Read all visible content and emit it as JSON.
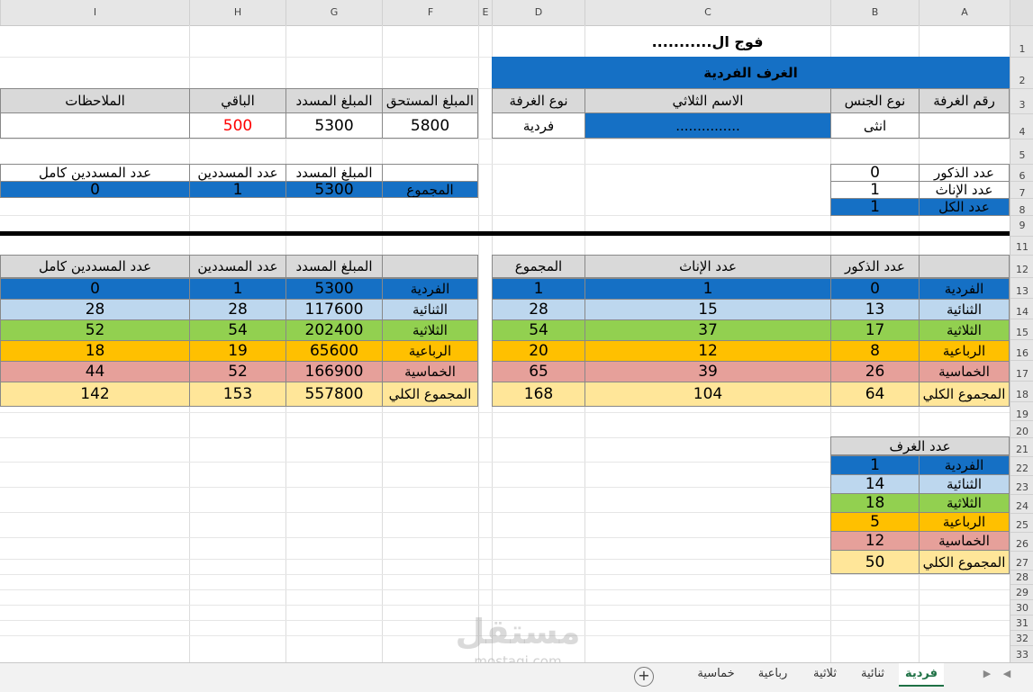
{
  "columns": [
    "A",
    "B",
    "C",
    "D",
    "E",
    "F",
    "G",
    "H",
    "I"
  ],
  "rows": [
    "1",
    "2",
    "3",
    "4",
    "5",
    "6",
    "7",
    "8",
    "9",
    "11",
    "12",
    "13",
    "14",
    "15",
    "16",
    "17",
    "18",
    "19",
    "20",
    "21",
    "22",
    "23",
    "24",
    "25",
    "26",
    "27",
    "28",
    "29",
    "30",
    "31",
    "32",
    "33"
  ],
  "title": "فوج ال...........",
  "section_title": "الغرف الفردية",
  "info": {
    "h_room_no": "رقم الغرفة",
    "h_gender": "نوع الجنس",
    "h_name": "الاسم الثلاثي",
    "h_room_type": "نوع الغرفة",
    "h_due": "المبلغ المستحق",
    "h_paid": "المبلغ المسدد",
    "h_remaining": "الباقي",
    "h_notes": "الملاحظات",
    "gender": "انثى",
    "name": "...............",
    "room_type": "فردية",
    "due": "5800",
    "paid": "5300",
    "remaining": "500",
    "notes": ""
  },
  "counts": {
    "males_label": "عدد الذكور",
    "males": "0",
    "females_label": "عدد الإناث",
    "females": "1",
    "total_label": "عدد الكل",
    "total": "1"
  },
  "summary": {
    "h_paid": "المبلغ المسدد",
    "h_payers": "عدد المسددين",
    "h_full_payers": "عدد المسددين كامل",
    "label": "المجموع",
    "paid": "5300",
    "payers": "1",
    "full_payers": "0"
  },
  "left_table": {
    "headers": [
      "عدد الذكور",
      "عدد الإناث",
      "المجموع"
    ],
    "rows": [
      {
        "label": "الفردية",
        "males": "0",
        "females": "1",
        "total": "1"
      },
      {
        "label": "الثنائية",
        "males": "13",
        "females": "15",
        "total": "28"
      },
      {
        "label": "الثلاثية",
        "males": "17",
        "females": "37",
        "total": "54"
      },
      {
        "label": "الرباعية",
        "males": "8",
        "females": "12",
        "total": "20"
      },
      {
        "label": "الخماسية",
        "males": "26",
        "females": "39",
        "total": "65"
      },
      {
        "label": "المجموع الكلي",
        "males": "64",
        "females": "104",
        "total": "168"
      }
    ]
  },
  "right_table": {
    "headers": [
      "المبلغ المسدد",
      "عدد المسددين",
      "عدد المسددين كامل"
    ],
    "rows": [
      {
        "label": "الفردية",
        "paid": "5300",
        "payers": "1",
        "full": "0"
      },
      {
        "label": "الثنائية",
        "paid": "117600",
        "payers": "28",
        "full": "28"
      },
      {
        "label": "الثلاثية",
        "paid": "202400",
        "payers": "54",
        "full": "52"
      },
      {
        "label": "الرباعية",
        "paid": "65600",
        "payers": "19",
        "full": "18"
      },
      {
        "label": "الخماسية",
        "paid": "166900",
        "payers": "52",
        "full": "44"
      },
      {
        "label": "المجموع الكلي",
        "paid": "557800",
        "payers": "153",
        "full": "142"
      }
    ]
  },
  "rooms_table": {
    "header": "عدد الغرف",
    "rows": [
      {
        "label": "الفردية",
        "value": "1"
      },
      {
        "label": "الثنائية",
        "value": "14"
      },
      {
        "label": "الثلاثية",
        "value": "18"
      },
      {
        "label": "الرباعية",
        "value": "5"
      },
      {
        "label": "الخماسية",
        "value": "12"
      },
      {
        "label": "المجموع الكلي",
        "value": "50"
      }
    ]
  },
  "sheet_tabs": [
    "فردية",
    "ثنائية",
    "ثلاثية",
    "رباعية",
    "خماسية"
  ],
  "active_tab": "فردية",
  "watermark": {
    "brand": "مستقل",
    "domain": "mostaqi.com"
  },
  "colors": {
    "blue": "#1570c5",
    "light_blue": "#bdd7ee",
    "green": "#92d050",
    "orange": "#ffc000",
    "pink": "#e6a09a",
    "yellow": "#ffe699",
    "gray": "#d9d9d9",
    "red_value": "#ff0000",
    "tab_active": "#1e7145"
  }
}
